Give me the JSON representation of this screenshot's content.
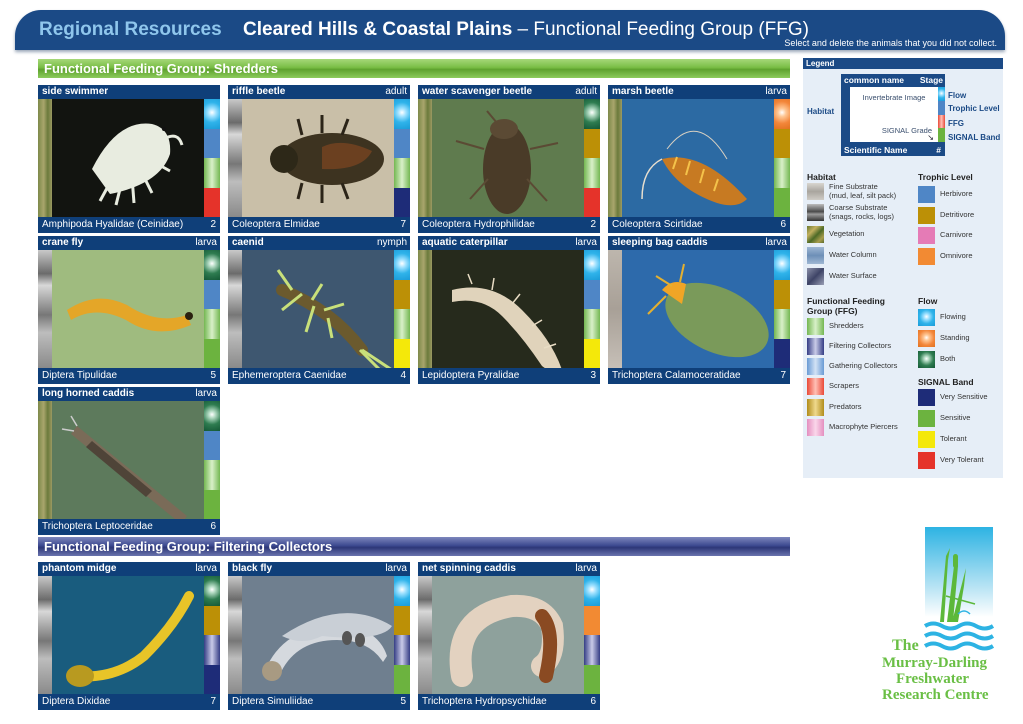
{
  "header": {
    "brand": "Regional Resources",
    "region": "Cleared Hills & Coastal Plains",
    "separator": " – ",
    "subject": "Functional Feeding Group (FFG)",
    "instruction": "Select and delete the animals that you did not collect."
  },
  "groups": [
    {
      "label": "Functional Feeding Group:  Shredders",
      "color": "#79bd45",
      "cards": [
        {
          "common_name": "side swimmer",
          "stage": "",
          "scientific_name": "Amphipoda Hyalidae (Ceinidae)",
          "signal_grade": "2",
          "habitat": "vegetation",
          "flow": "flowing",
          "trophic": "herbivore",
          "ffg": "shredders",
          "signal_band": "very-tolerant",
          "image_bg": "#121410",
          "specimen": "pale-amphipod"
        },
        {
          "common_name": "riffle beetle",
          "stage": "adult",
          "scientific_name": "Coleoptera Elmidae",
          "signal_grade": "7",
          "habitat": "coarse",
          "flow": "flowing",
          "trophic": "herbivore",
          "ffg": "shredders",
          "signal_band": "very-sensitive",
          "image_bg": "#c9bfa8",
          "specimen": "dark-beetle"
        },
        {
          "common_name": "water scavenger beetle",
          "stage": "adult",
          "scientific_name": "Coleoptera Hydrophilidae",
          "signal_grade": "2",
          "habitat": "vegetation",
          "flow": "both",
          "trophic": "detritivore",
          "ffg": "shredders",
          "signal_band": "very-tolerant",
          "image_bg": "#5f7b4e",
          "specimen": "brown-beetle"
        },
        {
          "common_name": "marsh beetle",
          "stage": "larva",
          "scientific_name": "Coleoptera Scirtidae",
          "signal_grade": "6",
          "habitat": "vegetation",
          "flow": "standing",
          "trophic": "detritivore",
          "ffg": "shredders",
          "signal_band": "sensitive",
          "image_bg": "#2c6aa3",
          "specimen": "orange-larva"
        },
        {
          "common_name": "crane fly",
          "stage": "larva",
          "scientific_name": "Diptera Tipulidae",
          "signal_grade": "5",
          "habitat": "coarse",
          "flow": "both",
          "trophic": "herbivore",
          "ffg": "shredders",
          "signal_band": "sensitive",
          "image_bg": "#9fbb7f",
          "specimen": "yellow-larva"
        },
        {
          "common_name": "caenid",
          "stage": "nymph",
          "scientific_name": "Ephemeroptera Caenidae",
          "signal_grade": "4",
          "habitat": "coarse",
          "flow": "flowing",
          "trophic": "detritivore",
          "ffg": "shredders",
          "signal_band": "tolerant",
          "image_bg": "#3e5770",
          "specimen": "green-nymph"
        },
        {
          "common_name": "aquatic caterpillar",
          "stage": "larva",
          "scientific_name": "Lepidoptera Pyralidae",
          "signal_grade": "3",
          "habitat": "vegetation",
          "flow": "flowing",
          "trophic": "herbivore",
          "ffg": "shredders",
          "signal_band": "tolerant",
          "image_bg": "#262a1c",
          "specimen": "pale-caterpillar"
        },
        {
          "common_name": "sleeping bag caddis",
          "stage": "larva",
          "scientific_name": "Trichoptera Calamoceratidae",
          "signal_grade": "7",
          "habitat": "fine",
          "flow": "flowing",
          "trophic": "detritivore",
          "ffg": "shredders",
          "signal_band": "very-sensitive",
          "image_bg": "#2d6aab",
          "specimen": "leaf-case"
        },
        {
          "common_name": "long horned caddis",
          "stage": "larva",
          "scientific_name": "Trichoptera Leptoceridae",
          "signal_grade": "6",
          "habitat": "vegetation",
          "flow": "both",
          "trophic": "herbivore",
          "ffg": "shredders",
          "signal_band": "sensitive",
          "image_bg": "#5d7a5c",
          "specimen": "stick-case"
        }
      ]
    },
    {
      "label": "Functional Feeding Group:  Filtering Collectors",
      "color": "#3d4a90",
      "cards": [
        {
          "common_name": "phantom midge",
          "stage": "larva",
          "scientific_name": "Diptera Dixidae",
          "signal_grade": "7",
          "habitat": "coarse",
          "flow": "both",
          "trophic": "detritivore",
          "ffg": "filtering",
          "signal_band": "very-sensitive",
          "image_bg": "#195c7e",
          "specimen": "yellow-midge"
        },
        {
          "common_name": "black fly",
          "stage": "larva",
          "scientific_name": "Diptera Simuliidae",
          "signal_grade": "5",
          "habitat": "coarse",
          "flow": "flowing",
          "trophic": "detritivore",
          "ffg": "filtering",
          "signal_band": "sensitive",
          "image_bg": "#6f7f8f",
          "specimen": "grey-larva"
        },
        {
          "common_name": "net spinning caddis",
          "stage": "larva",
          "scientific_name": "Trichoptera Hydropsychidae",
          "signal_grade": "6",
          "habitat": "coarse",
          "flow": "flowing",
          "trophic": "omnivore",
          "ffg": "filtering",
          "signal_band": "sensitive",
          "image_bg": "#8ea19c",
          "specimen": "curled-caddis"
        }
      ]
    }
  ],
  "legend": {
    "title": "Legend",
    "diagram": {
      "common_name": "common name",
      "stage": "Stage",
      "image": "Invertebrate Image",
      "signal_grade": "SIGNAL Grade",
      "scientific_name": "Scientific Name",
      "number": "#",
      "habitat": "Habitat",
      "flow": "Flow",
      "trophic": "Trophic Level",
      "ffg": "FFG",
      "signal_band": "SIGNAL Band"
    },
    "habitat": {
      "title": "Habitat",
      "items": [
        {
          "label": "Fine Substrate",
          "sub": "(mud, leaf, silt pack)"
        },
        {
          "label": "Coarse Substrate",
          "sub": "(snags, rocks, logs)"
        },
        {
          "label": "Vegetation",
          "sub": ""
        },
        {
          "label": "Water Column",
          "sub": ""
        },
        {
          "label": "Water Surface",
          "sub": ""
        }
      ]
    },
    "trophic": {
      "title": "Trophic Level",
      "items": [
        {
          "label": "Herbivore",
          "color": "#4f86c6"
        },
        {
          "label": "Detritivore",
          "color": "#bc9006"
        },
        {
          "label": "Carnivore",
          "color": "#e57bb6"
        },
        {
          "label": "Omnivore",
          "color": "#f28a33"
        }
      ]
    },
    "ffg": {
      "title": "Functional Feeding Group (FFG)",
      "items": [
        {
          "label": "Shredders",
          "color": "#74b752"
        },
        {
          "label": "Filtering Collectors",
          "color": "#353d85"
        },
        {
          "label": "Gathering Collectors",
          "color": "#6a9bd4"
        },
        {
          "label": "Scrapers",
          "color": "#ea4a38"
        },
        {
          "label": "Predators",
          "color": "#b18d1c"
        },
        {
          "label": "Macrophyte Piercers",
          "color": "#e48fc0"
        }
      ]
    },
    "flow": {
      "title": "Flow",
      "items": [
        {
          "label": "Flowing",
          "color": "#2fb3ea"
        },
        {
          "label": "Standing",
          "color": "#f3863a"
        },
        {
          "label": "Both",
          "color": "#2e7c50"
        }
      ]
    },
    "signal": {
      "title": "SIGNAL Band",
      "items": [
        {
          "label": "Very Sensitive",
          "color": "#1e2c78"
        },
        {
          "label": "Sensitive",
          "color": "#6cb33f"
        },
        {
          "label": "Tolerant",
          "color": "#f4e80a"
        },
        {
          "label": "Very Tolerant",
          "color": "#e5332a"
        }
      ]
    }
  },
  "logo": {
    "line1": "The",
    "line2": "Murray-Darling",
    "line3": "Freshwater",
    "line4": "Research Centre"
  }
}
